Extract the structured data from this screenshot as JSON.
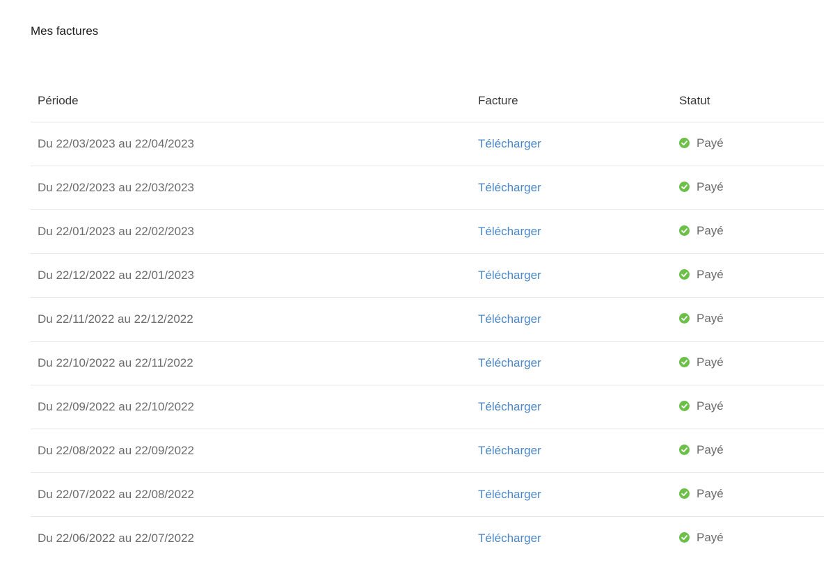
{
  "page": {
    "title": "Mes factures"
  },
  "table": {
    "headers": {
      "period": "Période",
      "invoice": "Facture",
      "status": "Statut"
    },
    "rows": [
      {
        "period": "Du 22/03/2023 au 22/04/2023",
        "invoice_link": "Télécharger",
        "status": "Payé",
        "status_icon": "check-circle-icon"
      },
      {
        "period": "Du 22/02/2023 au 22/03/2023",
        "invoice_link": "Télécharger",
        "status": "Payé",
        "status_icon": "check-circle-icon"
      },
      {
        "period": "Du 22/01/2023 au 22/02/2023",
        "invoice_link": "Télécharger",
        "status": "Payé",
        "status_icon": "check-circle-icon"
      },
      {
        "period": "Du 22/12/2022 au 22/01/2023",
        "invoice_link": "Télécharger",
        "status": "Payé",
        "status_icon": "check-circle-icon"
      },
      {
        "period": "Du 22/11/2022 au 22/12/2022",
        "invoice_link": "Télécharger",
        "status": "Payé",
        "status_icon": "check-circle-icon"
      },
      {
        "period": "Du 22/10/2022 au 22/11/2022",
        "invoice_link": "Télécharger",
        "status": "Payé",
        "status_icon": "check-circle-icon"
      },
      {
        "period": "Du 22/09/2022 au 22/10/2022",
        "invoice_link": "Télécharger",
        "status": "Payé",
        "status_icon": "check-circle-icon"
      },
      {
        "period": "Du 22/08/2022 au 22/09/2022",
        "invoice_link": "Télécharger",
        "status": "Payé",
        "status_icon": "check-circle-icon"
      },
      {
        "period": "Du 22/07/2022 au 22/08/2022",
        "invoice_link": "Télécharger",
        "status": "Payé",
        "status_icon": "check-circle-icon"
      },
      {
        "period": "Du 22/06/2022 au 22/07/2022",
        "invoice_link": "Télécharger",
        "status": "Payé",
        "status_icon": "check-circle-icon"
      }
    ]
  },
  "colors": {
    "link": "#4a86c5",
    "paid_status": "#6cc04a",
    "row_divider": "#e6e6e6"
  }
}
